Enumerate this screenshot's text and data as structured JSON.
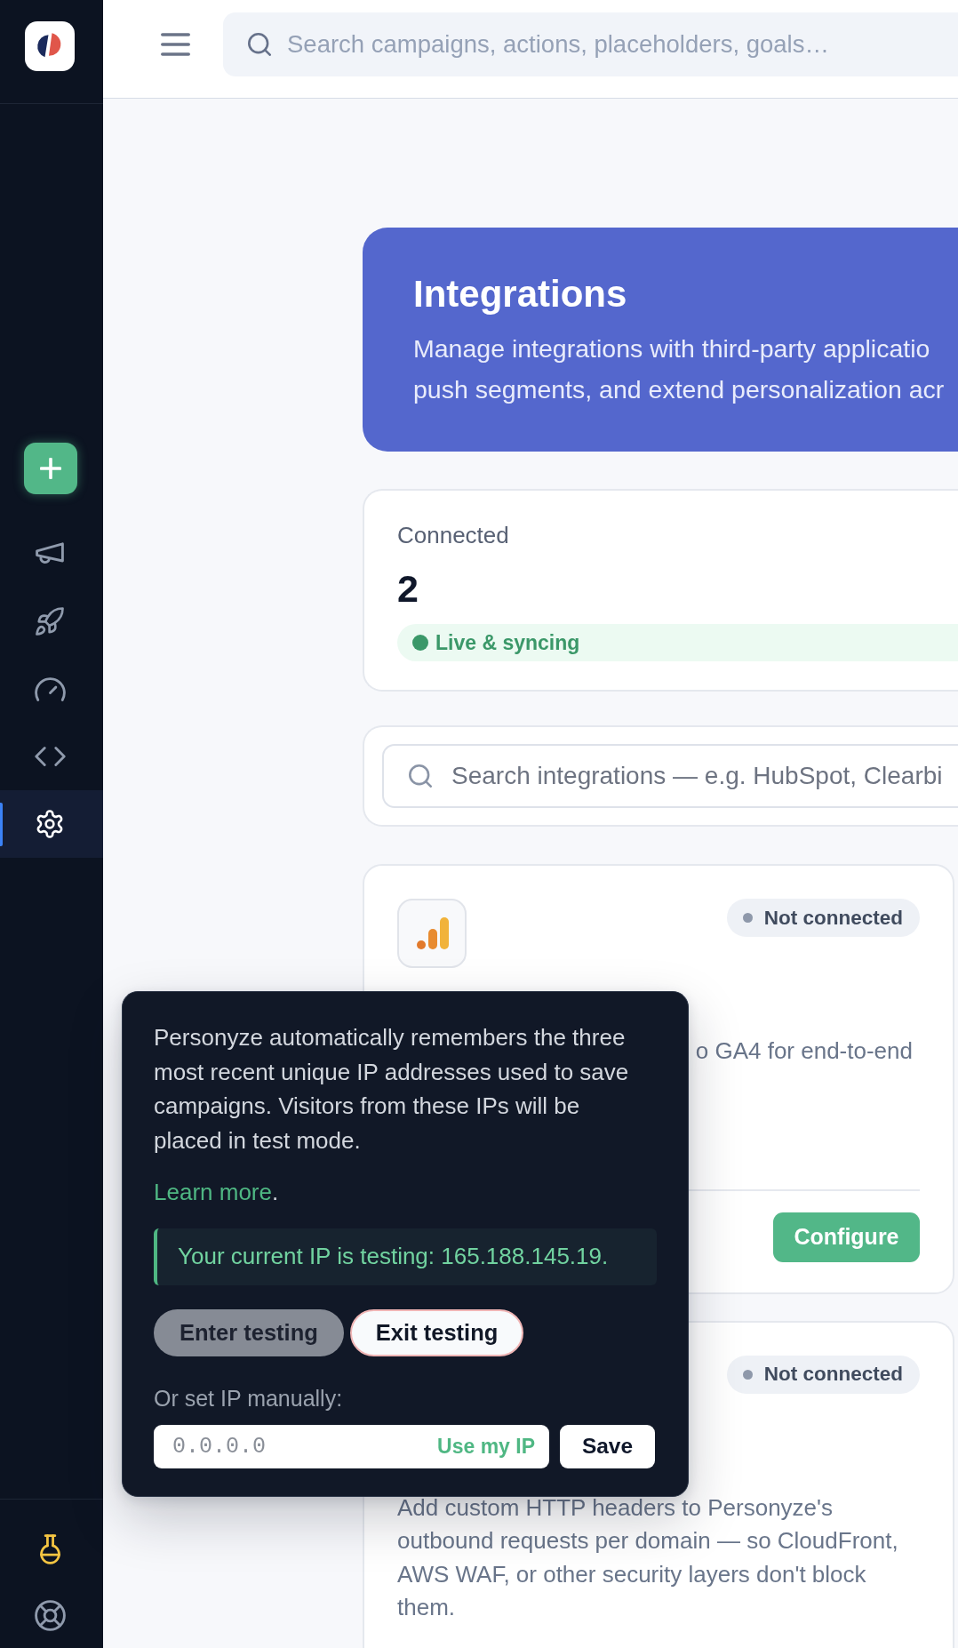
{
  "sidebar": {
    "nav": [
      {
        "selected": false
      },
      {
        "selected": false
      },
      {
        "selected": false
      },
      {
        "selected": false
      },
      {
        "selected": true
      }
    ]
  },
  "header": {
    "search": {
      "placeholder": "Search campaigns, actions, placeholders, goals…"
    }
  },
  "banner": {
    "title": "Integrations",
    "description_lines": [
      "Manage integrations with third-party applicatio",
      "push segments, and extend personalization acr"
    ]
  },
  "summary": {
    "label": "Connected",
    "value": "2",
    "status": "Live & syncing"
  },
  "integration_search": {
    "placeholder": "Search integrations — e.g. HubSpot, Clearbi"
  },
  "integrations": [
    {
      "kind": "analytics",
      "status": "Not connected",
      "description": "o GA4 for end-to-end",
      "action": "Configure"
    },
    {
      "kind": "custom-headers",
      "status": "Not connected",
      "description": "Add custom HTTP headers to Personyze's outbound requests per domain — so CloudFront, AWS WAF, or other security layers don't block them."
    }
  ],
  "test_mode_popover": {
    "text": "Personyze automatically remembers the three most recent unique IP addresses used to save campaigns. Visitors from these IPs will be placed in test mode.",
    "link": "Learn more",
    "link_suffix": ".",
    "notice": "Your current IP is testing: 165.188.145.19.",
    "buttons": [
      {
        "label": "Enter testing",
        "disabled": true
      },
      {
        "label": "Exit testing",
        "disabled": false
      }
    ],
    "manual_label": "Or set IP manually:",
    "ip_field": {
      "placeholder": "0.0.0.0",
      "action": "Use my IP"
    },
    "save": "Save"
  }
}
